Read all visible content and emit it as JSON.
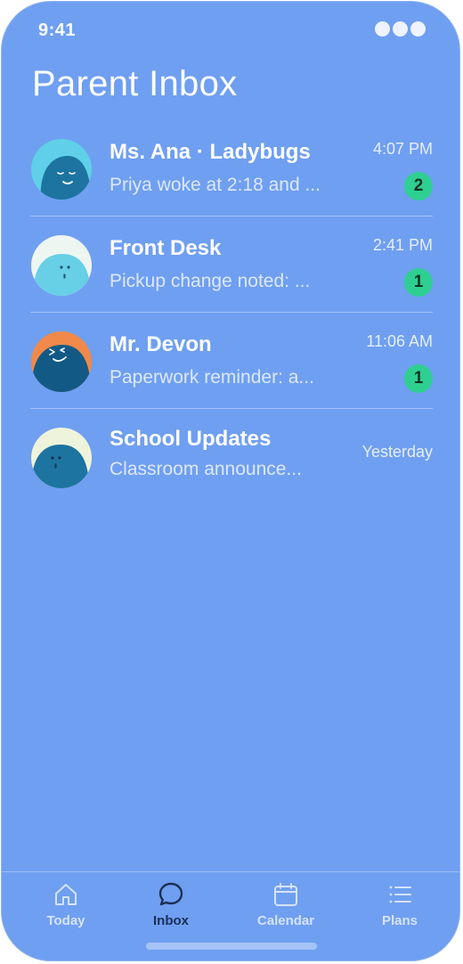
{
  "status_bar": {
    "time": "9:41"
  },
  "header": {
    "title": "Parent Inbox"
  },
  "threads": [
    {
      "name": "Ms. Ana · Ladybugs",
      "preview": "Priya woke at 2:18 and ...",
      "time": "4:07 PM",
      "unread": "2",
      "avatar_icon": "sleepy-face-avatar"
    },
    {
      "name": "Front Desk",
      "preview": "Pickup change noted: ...",
      "time": "2:41 PM",
      "unread": "1",
      "avatar_icon": "whistling-face-avatar"
    },
    {
      "name": "Mr. Devon",
      "preview": "Paperwork reminder: a...",
      "time": "11:06 AM",
      "unread": "1",
      "avatar_icon": "winking-face-avatar"
    },
    {
      "name": "School Updates",
      "preview": "Classroom announce...",
      "time": "Yesterday",
      "avatar_icon": "kissing-face-avatar"
    }
  ],
  "tab_bar": {
    "tabs": [
      {
        "label": "Today",
        "icon": "home-icon"
      },
      {
        "label": "Inbox",
        "icon": "chat-bubble-icon",
        "active": true
      },
      {
        "label": "Calendar",
        "icon": "calendar-icon"
      },
      {
        "label": "Plans",
        "icon": "list-icon"
      }
    ]
  },
  "colors": {
    "background": "#6f9ff1",
    "badge": "#2ecf91",
    "active_tab": "#1c2f55"
  }
}
